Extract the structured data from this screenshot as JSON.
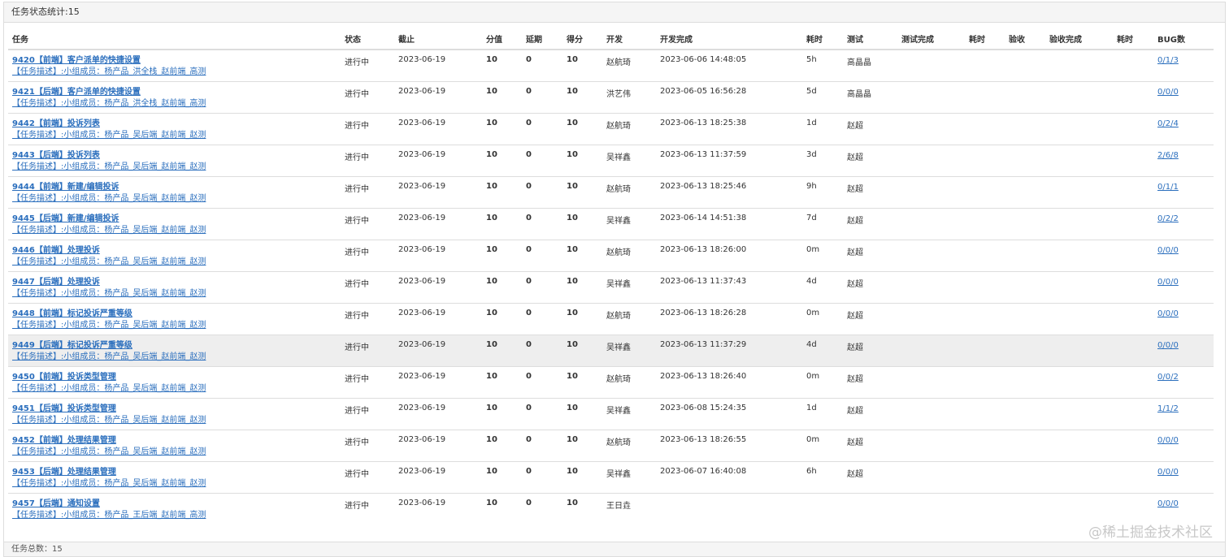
{
  "panel": {
    "heading": "任务状态统计:15",
    "footer": "任务总数：15"
  },
  "columns": [
    "任务",
    "状态",
    "截止",
    "分值",
    "延期",
    "得分",
    "开发",
    "开发完成",
    "耗时",
    "测试",
    "测试完成",
    "耗时",
    "验收",
    "验收完成",
    "耗时",
    "BUG数"
  ],
  "rows": [
    {
      "title": "9420【前端】客户派单的快捷设置",
      "desc": "【任务描述】:小组成员：杨产品_洪全栈_赵前端_高测",
      "status": "进行中",
      "deadline": "2023-06-19",
      "score_value": "10",
      "delay": "0",
      "score": "10",
      "dev": "赵航琦",
      "dev_done": "2023-06-06 14:48:05",
      "dev_time": "5h",
      "tester": "高晶晶",
      "test_done": "",
      "test_time": "",
      "acceptor": "",
      "accept_done": "",
      "accept_time": "",
      "bugs": "0/1/3"
    },
    {
      "title": "9421【后端】客户派单的快捷设置",
      "desc": "【任务描述】:小组成员：杨产品_洪全栈_赵前端_高测",
      "status": "进行中",
      "deadline": "2023-06-19",
      "score_value": "10",
      "delay": "0",
      "score": "10",
      "dev": "洪艺伟",
      "dev_done": "2023-06-05 16:56:28",
      "dev_time": "5d",
      "tester": "高晶晶",
      "test_done": "",
      "test_time": "",
      "acceptor": "",
      "accept_done": "",
      "accept_time": "",
      "bugs": "0/0/0"
    },
    {
      "title": "9442【前端】投诉列表",
      "desc": "【任务描述】:小组成员：杨产品_吴后端_赵前端_赵测",
      "status": "进行中",
      "deadline": "2023-06-19",
      "score_value": "10",
      "delay": "0",
      "score": "10",
      "dev": "赵航琦",
      "dev_done": "2023-06-13 18:25:38",
      "dev_time": "1d",
      "tester": "赵超",
      "test_done": "",
      "test_time": "",
      "acceptor": "",
      "accept_done": "",
      "accept_time": "",
      "bugs": "0/2/4"
    },
    {
      "title": "9443【后端】投诉列表",
      "desc": "【任务描述】:小组成员：杨产品_吴后端_赵前端_赵测",
      "status": "进行中",
      "deadline": "2023-06-19",
      "score_value": "10",
      "delay": "0",
      "score": "10",
      "dev": "吴祥鑫",
      "dev_done": "2023-06-13 11:37:59",
      "dev_time": "3d",
      "tester": "赵超",
      "test_done": "",
      "test_time": "",
      "acceptor": "",
      "accept_done": "",
      "accept_time": "",
      "bugs": "2/6/8"
    },
    {
      "title": "9444【前端】新建/编辑投诉",
      "desc": "【任务描述】:小组成员：杨产品_吴后端_赵前端_赵测",
      "status": "进行中",
      "deadline": "2023-06-19",
      "score_value": "10",
      "delay": "0",
      "score": "10",
      "dev": "赵航琦",
      "dev_done": "2023-06-13 18:25:46",
      "dev_time": "9h",
      "tester": "赵超",
      "test_done": "",
      "test_time": "",
      "acceptor": "",
      "accept_done": "",
      "accept_time": "",
      "bugs": "0/1/1"
    },
    {
      "title": "9445【后端】新建/编辑投诉",
      "desc": "【任务描述】:小组成员：杨产品_吴后端_赵前端_赵测",
      "status": "进行中",
      "deadline": "2023-06-19",
      "score_value": "10",
      "delay": "0",
      "score": "10",
      "dev": "吴祥鑫",
      "dev_done": "2023-06-14 14:51:38",
      "dev_time": "7d",
      "tester": "赵超",
      "test_done": "",
      "test_time": "",
      "acceptor": "",
      "accept_done": "",
      "accept_time": "",
      "bugs": "0/2/2"
    },
    {
      "title": "9446【前端】处理投诉",
      "desc": "【任务描述】:小组成员：杨产品_吴后端_赵前端_赵测",
      "status": "进行中",
      "deadline": "2023-06-19",
      "score_value": "10",
      "delay": "0",
      "score": "10",
      "dev": "赵航琦",
      "dev_done": "2023-06-13 18:26:00",
      "dev_time": "0m",
      "tester": "赵超",
      "test_done": "",
      "test_time": "",
      "acceptor": "",
      "accept_done": "",
      "accept_time": "",
      "bugs": "0/0/0"
    },
    {
      "title": "9447【后端】处理投诉",
      "desc": "【任务描述】:小组成员：杨产品_吴后端_赵前端_赵测",
      "status": "进行中",
      "deadline": "2023-06-19",
      "score_value": "10",
      "delay": "0",
      "score": "10",
      "dev": "吴祥鑫",
      "dev_done": "2023-06-13 11:37:43",
      "dev_time": "4d",
      "tester": "赵超",
      "test_done": "",
      "test_time": "",
      "acceptor": "",
      "accept_done": "",
      "accept_time": "",
      "bugs": "0/0/0"
    },
    {
      "title": "9448【前端】标记投诉严重等级",
      "desc": "【任务描述】:小组成员：杨产品_吴后端_赵前端_赵测",
      "status": "进行中",
      "deadline": "2023-06-19",
      "score_value": "10",
      "delay": "0",
      "score": "10",
      "dev": "赵航琦",
      "dev_done": "2023-06-13 18:26:28",
      "dev_time": "0m",
      "tester": "赵超",
      "test_done": "",
      "test_time": "",
      "acceptor": "",
      "accept_done": "",
      "accept_time": "",
      "bugs": "0/0/0"
    },
    {
      "title": "9449【后端】标记投诉严重等级",
      "desc": "【任务描述】:小组成员：杨产品_吴后端_赵前端_赵测",
      "status": "进行中",
      "deadline": "2023-06-19",
      "score_value": "10",
      "delay": "0",
      "score": "10",
      "dev": "吴祥鑫",
      "dev_done": "2023-06-13 11:37:29",
      "dev_time": "4d",
      "tester": "赵超",
      "test_done": "",
      "test_time": "",
      "acceptor": "",
      "accept_done": "",
      "accept_time": "",
      "bugs": "0/0/0",
      "highlight": true
    },
    {
      "title": "9450【前端】投诉类型管理",
      "desc": "【任务描述】:小组成员：杨产品_吴后端_赵前端_赵测",
      "status": "进行中",
      "deadline": "2023-06-19",
      "score_value": "10",
      "delay": "0",
      "score": "10",
      "dev": "赵航琦",
      "dev_done": "2023-06-13 18:26:40",
      "dev_time": "0m",
      "tester": "赵超",
      "test_done": "",
      "test_time": "",
      "acceptor": "",
      "accept_done": "",
      "accept_time": "",
      "bugs": "0/0/2"
    },
    {
      "title": "9451【后端】投诉类型管理",
      "desc": "【任务描述】:小组成员：杨产品_吴后端_赵前端_赵测",
      "status": "进行中",
      "deadline": "2023-06-19",
      "score_value": "10",
      "delay": "0",
      "score": "10",
      "dev": "吴祥鑫",
      "dev_done": "2023-06-08 15:24:35",
      "dev_time": "1d",
      "tester": "赵超",
      "test_done": "",
      "test_time": "",
      "acceptor": "",
      "accept_done": "",
      "accept_time": "",
      "bugs": "1/1/2"
    },
    {
      "title": "9452【前端】处理结果管理",
      "desc": "【任务描述】:小组成员：杨产品_吴后端_赵前端_赵测",
      "status": "进行中",
      "deadline": "2023-06-19",
      "score_value": "10",
      "delay": "0",
      "score": "10",
      "dev": "赵航琦",
      "dev_done": "2023-06-13 18:26:55",
      "dev_time": "0m",
      "tester": "赵超",
      "test_done": "",
      "test_time": "",
      "acceptor": "",
      "accept_done": "",
      "accept_time": "",
      "bugs": "0/0/0"
    },
    {
      "title": "9453【后端】处理结果管理",
      "desc": "【任务描述】:小组成员：杨产品_吴后端_赵前端_赵测",
      "status": "进行中",
      "deadline": "2023-06-19",
      "score_value": "10",
      "delay": "0",
      "score": "10",
      "dev": "吴祥鑫",
      "dev_done": "2023-06-07 16:40:08",
      "dev_time": "6h",
      "tester": "赵超",
      "test_done": "",
      "test_time": "",
      "acceptor": "",
      "accept_done": "",
      "accept_time": "",
      "bugs": "0/0/0"
    },
    {
      "title": "9457【后端】通知设置",
      "desc": "【任务描述】:小组成员：杨产品_王后端_赵前端_高测",
      "status": "进行中",
      "deadline": "2023-06-19",
      "score_value": "10",
      "delay": "0",
      "score": "10",
      "dev": "王日垚",
      "dev_done": "",
      "dev_time": "",
      "tester": "",
      "test_done": "",
      "test_time": "",
      "acceptor": "",
      "accept_done": "",
      "accept_time": "",
      "bugs": "0/0/0"
    }
  ],
  "watermark": "@稀土掘金技术社区",
  "colors": {
    "link": "#2a6ebd",
    "border": "#dddddd",
    "highlight_row": "#eeeeee",
    "panel_bg": "#f5f5f5"
  }
}
